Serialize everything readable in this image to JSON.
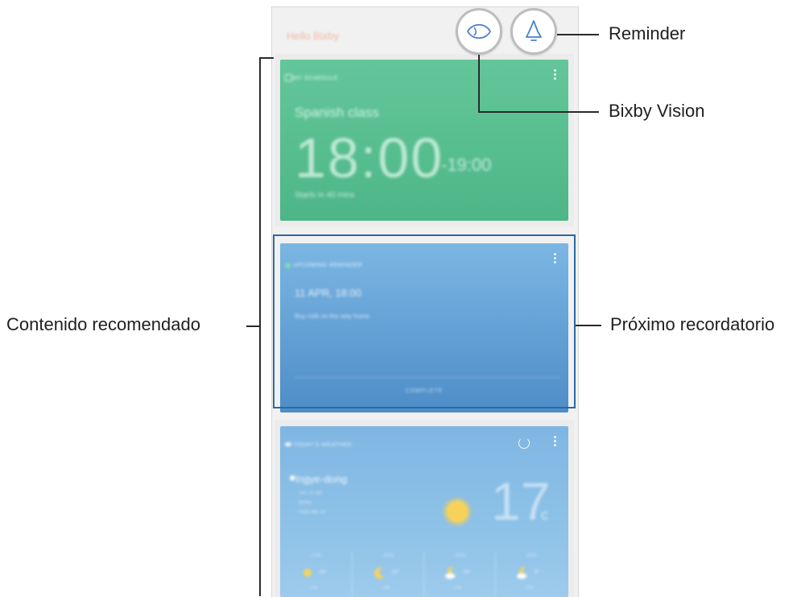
{
  "app": {
    "greeting": "Hello Bixby"
  },
  "cards": {
    "schedule": {
      "header": "MY SCHEDULE",
      "title": "Spanish class",
      "start_time": "18:00",
      "end_time": "-19:00",
      "starts_in": "Starts in 40 mins"
    },
    "reminder": {
      "header": "UPCOMING REMINDER",
      "datetime": "11 APR, 18:00",
      "note": "Buy milk on the way home",
      "action_label": "COMPLETE"
    },
    "weather": {
      "header": "TODAY'S WEATHER",
      "location": "Ingye-dong",
      "detail_lines": [
        "Tue, 11 Apr",
        "Sunny",
        "Feels like 16°"
      ],
      "temperature": "17",
      "unit": "c",
      "forecast": [
        {
          "time": "17:00",
          "icon": "sun-icon",
          "temp": "16°",
          "precip": "0%"
        },
        {
          "time": "20:00",
          "icon": "moon-icon",
          "temp": "13°",
          "precip": "0%"
        },
        {
          "time": "23:00",
          "icon": "moon-cloud-icon",
          "temp": "10°",
          "precip": "0%"
        },
        {
          "time": "02:00",
          "icon": "moon-cloud-icon",
          "temp": "8°",
          "precip": "0%"
        }
      ]
    }
  },
  "callouts": {
    "reminder": "Reminder",
    "bixby_vision": "Bixby Vision",
    "recommended": "Contenido recomendado",
    "next_reminder": "Próximo recordatorio"
  },
  "colors": {
    "schedule_card": "#56bd8e",
    "reminder_card": "#5b99d0",
    "weather_card": "#8ec2e8",
    "highlight_frame": "#2b6aa3",
    "greeting": "#f08a6a"
  }
}
